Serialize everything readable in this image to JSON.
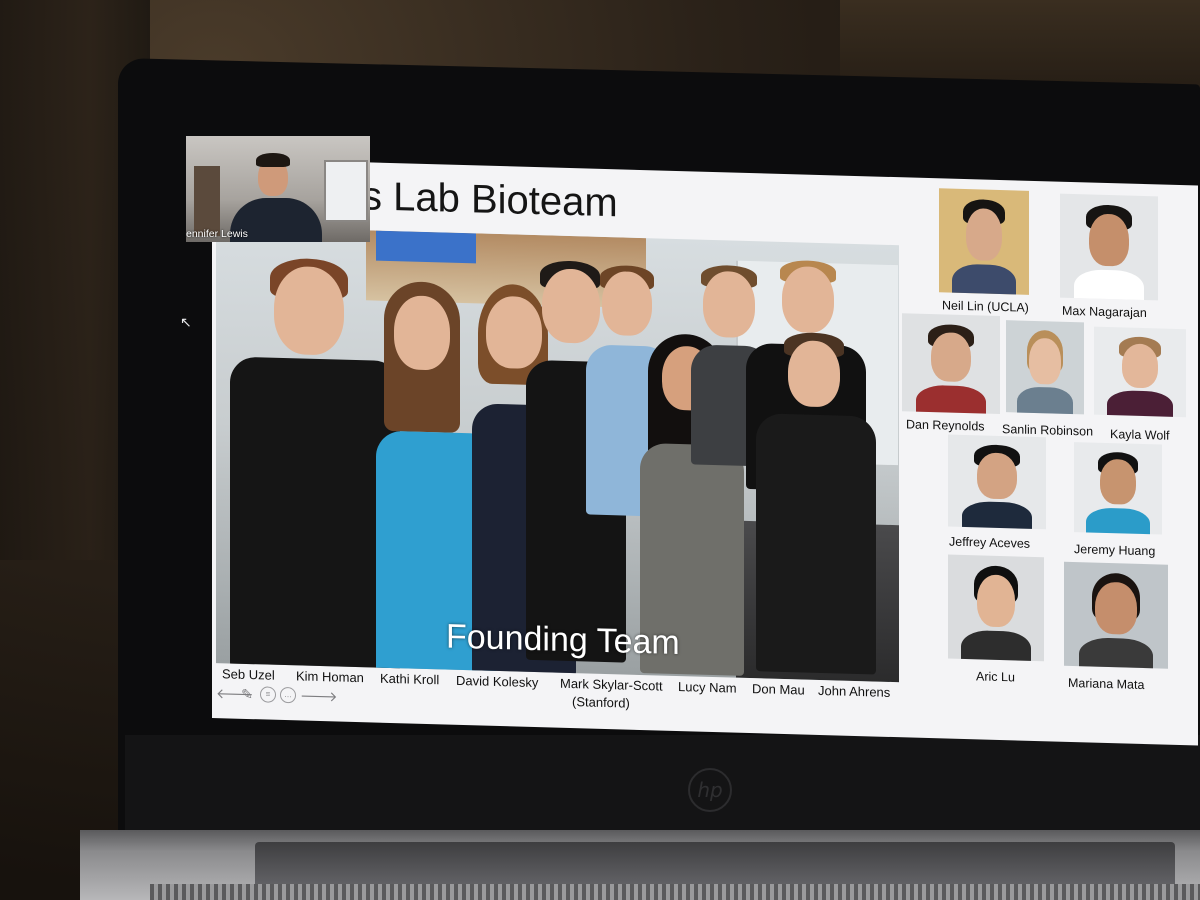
{
  "slide": {
    "title": "s Lab Bioteam",
    "photo_caption": "Founding Team",
    "founding_team": [
      {
        "name": "Seb Uzel"
      },
      {
        "name": "Kim Homan"
      },
      {
        "name": "Kathi Kroll"
      },
      {
        "name": "David Kolesky"
      },
      {
        "name": "Mark Skylar-Scott",
        "note": "(Stanford)"
      },
      {
        "name": "Lucy Nam"
      },
      {
        "name": "Don Mau"
      },
      {
        "name": "John Ahrens"
      }
    ],
    "members": [
      {
        "name": "Neil Lin (UCLA)"
      },
      {
        "name": "Max Nagarajan"
      },
      {
        "name": "Dan Reynolds"
      },
      {
        "name": "Sanlin Robinson"
      },
      {
        "name": "Kayla Wolf"
      },
      {
        "name": "Jeffrey Aceves"
      },
      {
        "name": "Jeremy Huang"
      },
      {
        "name": "Aric Lu"
      },
      {
        "name": "Mariana Mata"
      }
    ],
    "nav_icons": [
      "arrow-left-icon",
      "pen-icon",
      "menu-icon",
      "more-icon",
      "arrow-right-icon"
    ]
  },
  "video_call": {
    "participant_label": "ennifer Lewis"
  },
  "colors": {
    "slide_background": "#f4f4f6",
    "title_text": "#151515",
    "caption_text": "#ffffff",
    "laptop_bezel": "#0c0c0d"
  }
}
